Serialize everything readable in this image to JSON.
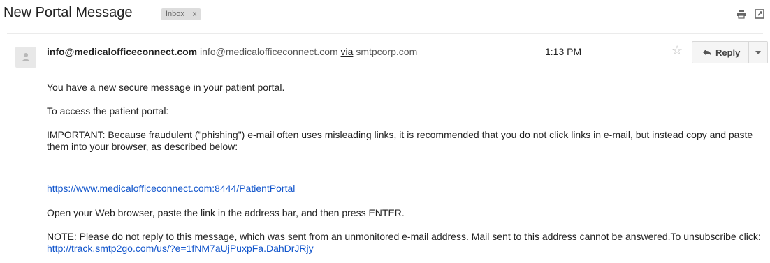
{
  "subject": "New Portal Message",
  "label": {
    "text": "Inbox",
    "close": "x"
  },
  "sender": {
    "name": "info@medicalofficeconnect.com",
    "email": "info@medicalofficeconnect.com",
    "via": "via",
    "via_domain": "smtpcorp.com"
  },
  "time": "1:13 PM",
  "reply_label": "Reply",
  "body": {
    "line1": "You have a new secure message in your patient portal.",
    "line2": "To access the patient portal:",
    "important": "IMPORTANT: Because fraudulent (\"phishing\") e-mail often uses misleading links, it is recommended that you do not click links in e-mail, but instead copy and paste them into your browser, as described below:",
    "portal_link": "https://www.medicalofficeconnect.com:8444/PatientPortal",
    "instructions": "Open your Web browser, paste the link in the address bar, and then press ENTER.",
    "note": "NOTE: Please do not reply to this message, which was sent from an unmonitored e-mail address. Mail sent to this address cannot be answered.To unsubscribe click: ",
    "unsubscribe_link": "http://track.smtp2go.com/us/?e=1fNM7aUjPuxpFa.DahDrJRjy"
  },
  "icons": {
    "print": "print-icon",
    "new_window": "new-window-icon",
    "avatar": "person-icon",
    "star": "star-icon",
    "reply": "reply-arrow-icon",
    "more": "caret-down-icon"
  },
  "colors": {
    "link": "#1155cc",
    "label_bg": "#dddddd",
    "star": "#c4c4c4"
  }
}
